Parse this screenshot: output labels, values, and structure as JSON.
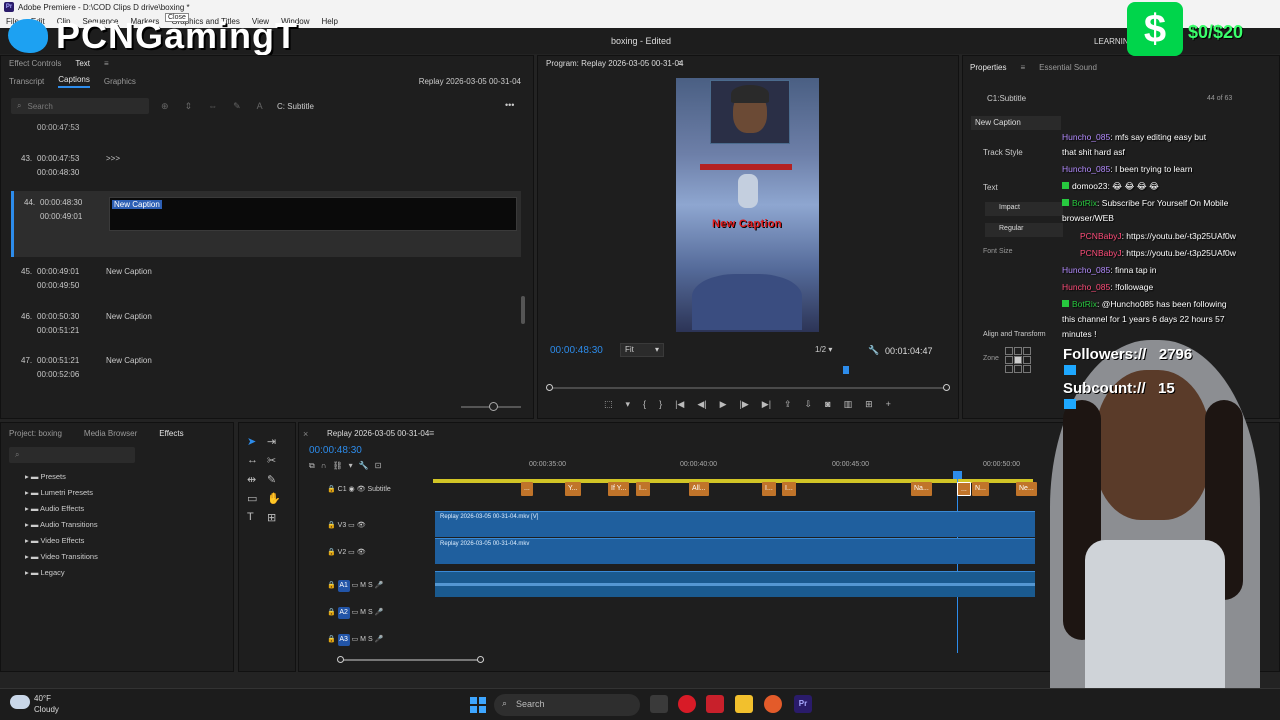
{
  "app": {
    "title": "Adobe Premiere - D:\\COD Clips D drive\\boxing *",
    "project_status": "boxing - Edited",
    "workspace_label": "LEARNIN",
    "close_tooltip": "Close"
  },
  "menu": {
    "items": [
      "File",
      "Edit",
      "Clip",
      "Sequence",
      "Markers",
      "Graphics and Titles",
      "View",
      "Window",
      "Help"
    ]
  },
  "overlay": {
    "brand": "PCNGamingT",
    "cash_amount": "$0/$20",
    "followers_label": "Followers://",
    "followers_value": "2796",
    "subcount_label": "Subcount://",
    "subcount_value": "15"
  },
  "left_panel": {
    "tabs": [
      "Effect Controls",
      "Text"
    ],
    "subtabs": [
      "Transcript",
      "Captions",
      "Graphics"
    ],
    "sequence_name": "Replay 2026-03-05 00-31-04",
    "search_placeholder": "Search",
    "track_name": "C: Subtitle",
    "top_time": "00:00:47:53",
    "captions": [
      {
        "num": "43.",
        "start": "00:00:47:53",
        "end": "00:00:48:30",
        "text": ">>>"
      },
      {
        "num": "44.",
        "start": "00:00:48:30",
        "end": "00:00:49:01",
        "text": "New Caption"
      },
      {
        "num": "45.",
        "start": "00:00:49:01",
        "end": "00:00:49:50",
        "text": "New Caption"
      },
      {
        "num": "46.",
        "start": "00:00:50:30",
        "end": "00:00:51:21",
        "text": "New Caption"
      },
      {
        "num": "47.",
        "start": "00:00:51:21",
        "end": "00:00:52:06",
        "text": "New Caption"
      }
    ]
  },
  "program": {
    "title": "Program: Replay 2026-03-05 00-31-04",
    "video_caption": "New Caption",
    "current_time": "00:00:48:30",
    "fit": "Fit",
    "resolution": "1/2",
    "duration": "00:01:04:47"
  },
  "properties": {
    "tabs": [
      "Properties",
      "Essential Sound"
    ],
    "track": "C1:Subtitle",
    "count": "44 of 63",
    "caption_field": "New Caption",
    "sections": [
      "Track Style",
      "Text",
      "Align and Transform"
    ],
    "font": "Impact",
    "style": "Regular",
    "font_size_label": "Font Size",
    "zone_label": "Zone"
  },
  "chat": [
    {
      "user": "Huncho_085",
      "msg": ": mfs say editing easy but",
      "cont": "that shit hard asf",
      "user_color": "purple"
    },
    {
      "user": "Huncho_085",
      "msg": ": I been trying to learn",
      "user_color": "purple"
    },
    {
      "user": "domoo23",
      "msg": ": 😂 😂 😂 😂",
      "user_color": "white"
    },
    {
      "user": "BotRix",
      "msg": ": Subscribe For Yourself On Mobile",
      "cont": "browser/WEB",
      "user_color": "green"
    },
    {
      "user": "PCNBabyJ",
      "msg": ": https://youtu.be/-t3p25UAf0w",
      "user_color": "red"
    },
    {
      "user": "PCNBabyJ",
      "msg": ": https://youtu.be/-t3p25UAf0w",
      "user_color": "red"
    },
    {
      "user": "Huncho_085",
      "msg": ": finna tap in",
      "user_color": "purple"
    },
    {
      "user": "Huncho_085",
      "msg": ": !followage",
      "user_color": "red"
    },
    {
      "user": "BotRix",
      "msg": ": @Huncho085 has been following",
      "cont": "this channel for 1 years 6 days 22 hours 57",
      "cont2": "minutes !",
      "user_color": "green"
    }
  ],
  "project_panel": {
    "tabs": [
      "Project: boxing",
      "Media Browser",
      "Effects"
    ],
    "folders": [
      "Presets",
      "Lumetri Presets",
      "Audio Effects",
      "Audio Transitions",
      "Video Effects",
      "Video Transitions",
      "Legacy"
    ]
  },
  "timeline": {
    "sequence": "Replay 2026-03-05 00-31-04",
    "current_time": "00:00:48:30",
    "ruler": [
      "00:00:35:00",
      "00:00:40:00",
      "00:00:45:00",
      "00:00:50:00"
    ],
    "subtitle_track": "Subtitle",
    "sub_chips": [
      "...",
      "Y...",
      "If Y...",
      "I...",
      "All...",
      "I...",
      "I...",
      "Na...",
      "...",
      "N...",
      "Ne..."
    ],
    "tracks": [
      {
        "id": "V3",
        "clip": "Replay 2026-03-05 00-31-04.mkv [V]"
      },
      {
        "id": "V2",
        "clip": "Replay 2026-03-05 00-31-04.mkv"
      },
      {
        "id": "A1",
        "clip": ""
      },
      {
        "id": "A2",
        "clip": ""
      },
      {
        "id": "A3",
        "clip": ""
      }
    ]
  },
  "taskbar": {
    "weather_temp": "40°F",
    "weather_desc": "Cloudy",
    "search": "Search"
  }
}
